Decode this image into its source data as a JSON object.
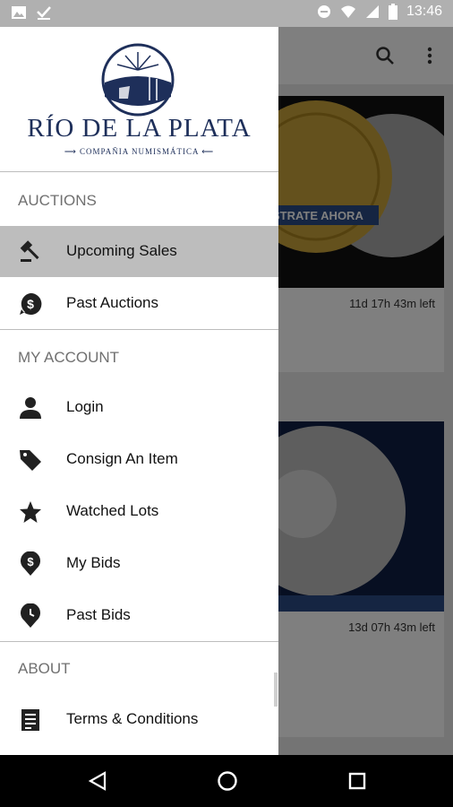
{
  "status_bar": {
    "time": "13:46"
  },
  "brand": {
    "title": "RÍO DE LA PLATA",
    "subtitle": "COMPAÑIA NUMISMÁTICA"
  },
  "drawer": {
    "sections": [
      {
        "title": "AUCTIONS",
        "items": [
          {
            "label": "Upcoming Sales",
            "icon": "gavel-icon",
            "active": true
          },
          {
            "label": "Past Auctions",
            "icon": "dollar-circle-icon",
            "active": false
          }
        ]
      },
      {
        "title": "MY ACCOUNT",
        "items": [
          {
            "label": "Login",
            "icon": "person-icon"
          },
          {
            "label": "Consign An Item",
            "icon": "tag-icon"
          },
          {
            "label": "Watched Lots",
            "icon": "star-icon"
          },
          {
            "label": "My Bids",
            "icon": "dollar-pin-icon"
          },
          {
            "label": "Past Bids",
            "icon": "clock-pin-icon"
          }
        ]
      },
      {
        "title": "ABOUT",
        "items": [
          {
            "label": "Terms & Conditions",
            "icon": "document-icon"
          }
        ]
      }
    ]
  },
  "background": {
    "cards": [
      {
        "banner": "STRATE AHORA",
        "time_left": "11d 17h 43m left"
      },
      {
        "time_left": "13d 07h 43m left"
      }
    ]
  },
  "colors": {
    "brand_navy": "#1e2f5a",
    "active_item": "#bdbdbd",
    "scrim": "rgba(0,0,0,0.5)"
  }
}
